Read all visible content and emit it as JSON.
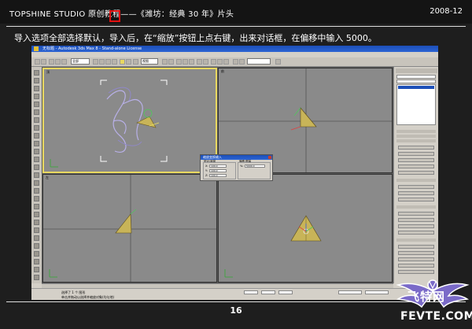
{
  "header": {
    "title": "TOPSHINE STUDIO 原创教程——《潍坊：经典 30 年》片头",
    "date": "2008-12"
  },
  "instruction": "导入选项全部选择默认，导入后，在“缩放”按钮上点右键，出来对话框，在偏移中输入 5000。",
  "page_number": "16",
  "app": {
    "title": "无标题 - Autodesk 3ds Max 8 - Stand-alone License",
    "menu": [
      "文件",
      "编辑",
      "工具",
      "组",
      "视图",
      "创建",
      "修改器",
      "reactor",
      "动画",
      "图表编辑器",
      "渲染",
      "自定义",
      "MAXScript",
      "帮助"
    ],
    "selection_dropdown": "全部",
    "view_dropdown": "视图",
    "panel_name_field": "Object",
    "status_selected": "选择了 1 个 图形",
    "status_prompt": "单击并拖动以选择并缩放对象(均匀地)",
    "viewports": [
      {
        "label": "顶",
        "active": true
      },
      {
        "label": "前"
      },
      {
        "label": "左"
      },
      {
        "label": "透视"
      }
    ]
  },
  "dialog": {
    "title": "缩放变换输入",
    "group_absolute": "绝对:局部",
    "group_offset": "偏移:屏幕",
    "fields": [
      {
        "label": "X:",
        "value": "100.0"
      },
      {
        "label": "Y:",
        "value": "100.0"
      },
      {
        "label": "Z:",
        "value": "100.0"
      }
    ],
    "offset_label": "%:",
    "offset_value": "5000.0"
  },
  "watermark": {
    "brand_cn": "飞特网",
    "brand_en": "FEVTE.COM"
  },
  "colors": {
    "page_bg": "#1e1e1e",
    "highlight_box": "#e01010",
    "active_viewport_border": "#e8d860",
    "watermark_wing": "#7a6ac8"
  }
}
